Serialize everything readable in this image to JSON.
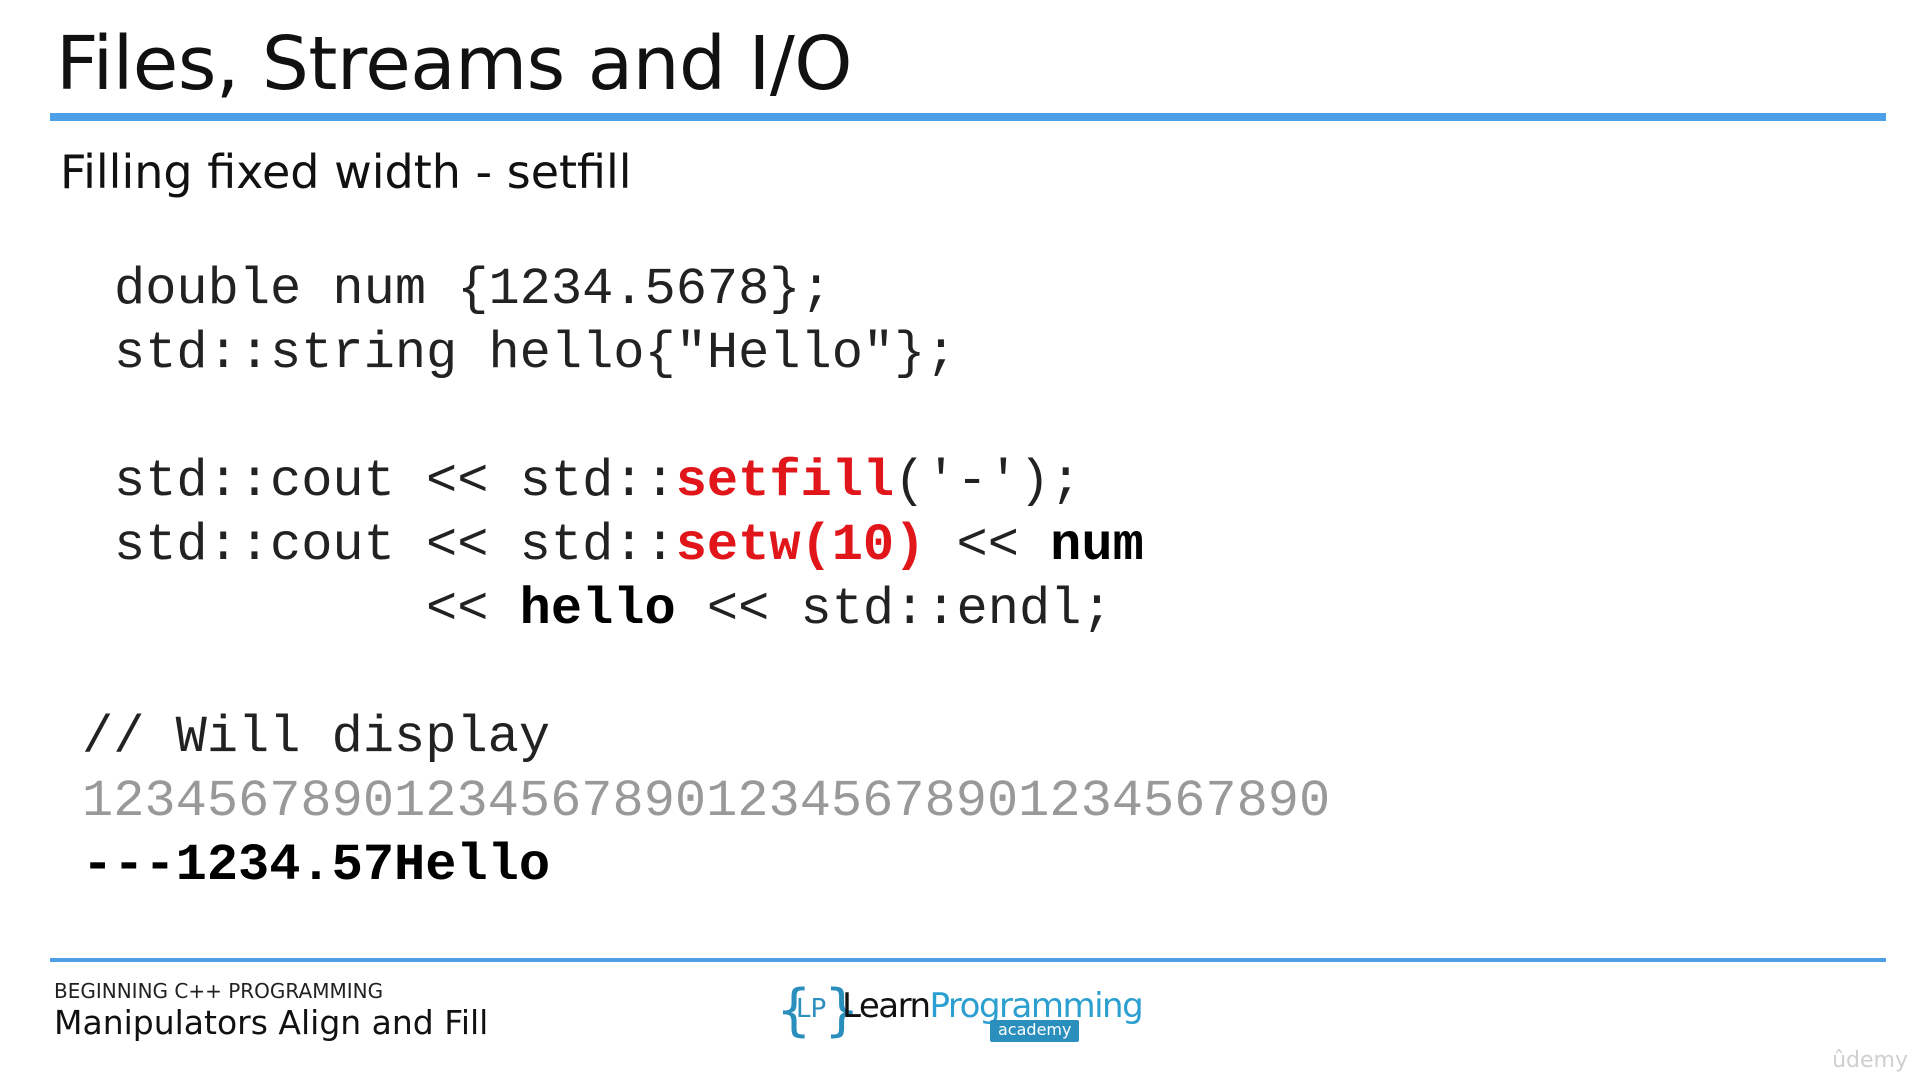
{
  "slide": {
    "title": "Files, Streams and I/O",
    "subtitle": "Filling fixed width - setfill"
  },
  "code": {
    "line1": "double num {1234.5678};",
    "line2": "std::string hello{\"Hello\"};",
    "line3_prefix": "std::cout << std::",
    "line3_red": "setfill",
    "line3_suffix": "('-');",
    "line4_prefix": "std::cout << std::",
    "line4_red": "setw(10)",
    "line4_mid": " << ",
    "line4_bold": "num",
    "line5_prefix": "          << ",
    "line5_bold": "hello",
    "line5_suffix": " << std::endl;"
  },
  "output": {
    "comment": "// Will display",
    "ruler": "1234567890123456789012345678901234567890",
    "result": "---1234.57Hello"
  },
  "footer": {
    "course": "BEGINNING C++ PROGRAMMING",
    "lecture": "Manipulators Align and Fill",
    "logo_brace_open": "{",
    "logo_lp": "LP",
    "logo_brace_close": "}",
    "logo_learn": "Learn",
    "logo_programming": "Programming",
    "logo_academy": "academy",
    "watermark": "ûdemy"
  },
  "colors": {
    "accent_rule": "#4da0e8",
    "code_highlight": "#e0161b",
    "ruler_gray": "#999999",
    "logo_blue": "#2a8fbd"
  }
}
